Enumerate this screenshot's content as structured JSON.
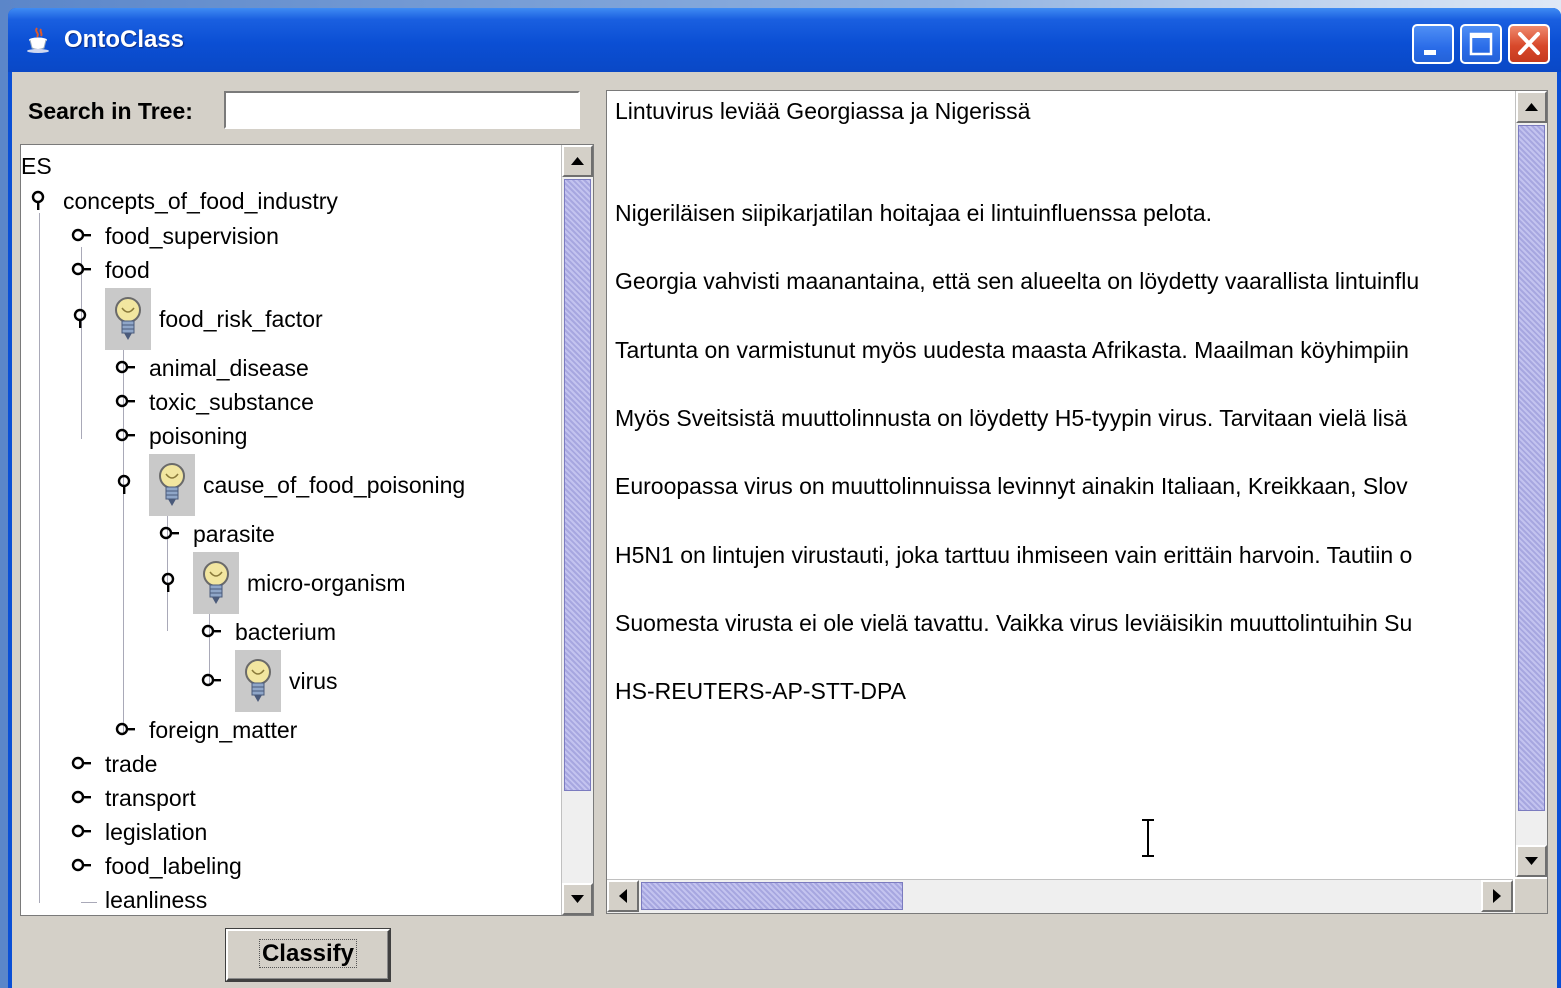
{
  "window": {
    "title": "OntoClass"
  },
  "search": {
    "label": "Search in Tree:",
    "value": ""
  },
  "tree": {
    "root": "ES",
    "nodes": [
      {
        "label": "concepts_of_food_industry",
        "handle": "expanded",
        "bulb": false
      },
      {
        "label": "food_supervision",
        "handle": "collapsed",
        "bulb": false
      },
      {
        "label": "food",
        "handle": "collapsed",
        "bulb": false
      },
      {
        "label": "food_risk_factor",
        "handle": "expanded",
        "bulb": true
      },
      {
        "label": "animal_disease",
        "handle": "collapsed",
        "bulb": false
      },
      {
        "label": "toxic_substance",
        "handle": "collapsed",
        "bulb": false
      },
      {
        "label": "poisoning",
        "handle": "collapsed",
        "bulb": false
      },
      {
        "label": "cause_of_food_poisoning",
        "handle": "expanded",
        "bulb": true
      },
      {
        "label": "parasite",
        "handle": "collapsed",
        "bulb": false
      },
      {
        "label": "micro-organism",
        "handle": "expanded",
        "bulb": true
      },
      {
        "label": "bacterium",
        "handle": "collapsed",
        "bulb": false
      },
      {
        "label": "virus",
        "handle": "collapsed",
        "bulb": true
      },
      {
        "label": "foreign_matter",
        "handle": "collapsed",
        "bulb": false
      },
      {
        "label": "trade",
        "handle": "collapsed",
        "bulb": false
      },
      {
        "label": "transport",
        "handle": "collapsed",
        "bulb": false
      },
      {
        "label": "legislation",
        "handle": "collapsed",
        "bulb": false
      },
      {
        "label": "food_labeling",
        "handle": "collapsed",
        "bulb": false
      },
      {
        "label": "leanliness",
        "handle": "leaf",
        "bulb": false
      }
    ]
  },
  "document": {
    "paragraphs": [
      "Lintuvirus leviää Georgiassa ja Nigerissä",
      "Nigeriläisen siipikarjatilan hoitajaa ei lintuinfluenssa pelota.",
      "Georgia vahvisti maanantaina, että sen alueelta on löydetty vaarallista lintuinflu",
      "Tartunta on varmistunut myös uudesta maasta Afrikasta. Maailman köyhimpiin",
      "Myös Sveitsistä   muuttolinnusta on löydetty H5-tyypin virus. Tarvitaan vielä lisä",
      "Euroopassa virus on muuttolinnuissa levinnyt ainakin Italiaan, Kreikkaan, Slov",
      "H5N1 on lintujen virustauti, joka tarttuu ihmiseen vain erittäin harvoin. Tautiin o",
      "Suomesta virusta ei ole vielä tavattu. Vaikka virus leviäisikin muuttolintuihin Su",
      "HS-REUTERS-AP-STT-DPA"
    ]
  },
  "buttons": {
    "classify": "Classify"
  },
  "icons": {
    "app": "java-cup-icon",
    "minimize": "minimize-icon",
    "maximize": "maximize-icon",
    "close": "close-icon",
    "bulb": "lightbulb-icon"
  },
  "colors": {
    "titlebar": "#0a4fd6",
    "panel": "#d4d0c8",
    "scroll_thumb": "#b4b4e8",
    "close": "#d8492b"
  }
}
